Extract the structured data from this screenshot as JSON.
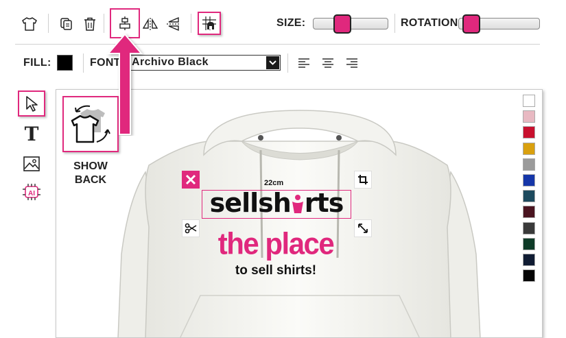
{
  "toolbar": {
    "size_label": "SIZE:",
    "rotation_label": "ROTATION:",
    "size_value": 0.35,
    "rotation_value": 0.05
  },
  "fill_bar": {
    "fill_label": "FILL:",
    "fill_color": "#000000",
    "font_label": "FONT:",
    "font_value": "Archivo Black"
  },
  "show_back": {
    "label_line1": "SHOW",
    "label_line2": "BACK"
  },
  "design": {
    "dimension_label": "22cm",
    "logo_text_1": "sellsh",
    "logo_text_2": "rts",
    "headline": "the place",
    "subline": "to sell shirts!"
  },
  "colors": {
    "accent": "#e0287d",
    "swatches": [
      "#ffffff",
      "#e8b9c2",
      "#c8102e",
      "#d9a00f",
      "#9b9b9b",
      "#1536a8",
      "#1d4a5e",
      "#4a1420",
      "#3a3a3a",
      "#0e3b27",
      "#101c33",
      "#050505"
    ]
  },
  "icons": [
    "shirt-icon",
    "duplicate-icon",
    "trash-icon",
    "align-center-icon",
    "flip-horizontal-icon",
    "flip-vertical-icon",
    "grid-snap-icon",
    "pointer-icon",
    "text-icon",
    "image-icon",
    "ai-icon",
    "close-icon",
    "crop-icon",
    "scissors-icon",
    "resize-icon",
    "dropdown-arrow-icon",
    "align-left-icon",
    "align-center-text-icon",
    "align-right-icon"
  ]
}
